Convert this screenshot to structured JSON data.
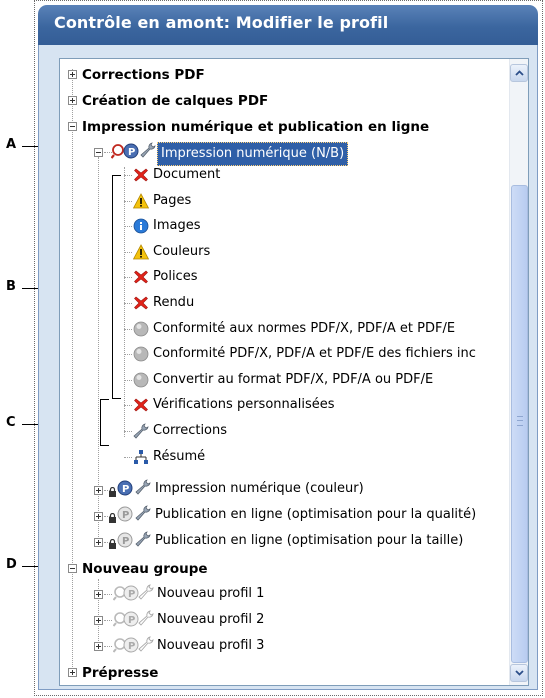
{
  "window": {
    "title": "Contrôle en amont: Modifier le profil"
  },
  "tree": {
    "corrections_pdf": "Corrections PDF",
    "creation_calques": "Création de calques PDF",
    "impression_publication": "Impression numérique et publication en ligne",
    "impression_nb": "Impression numérique (N/B)",
    "children": [
      {
        "label": "Document",
        "icon": "error-x-icon"
      },
      {
        "label": "Pages",
        "icon": "warning-icon"
      },
      {
        "label": "Images",
        "icon": "info-icon"
      },
      {
        "label": "Couleurs",
        "icon": "warning-icon"
      },
      {
        "label": "Polices",
        "icon": "error-x-icon"
      },
      {
        "label": "Rendu",
        "icon": "error-x-icon"
      },
      {
        "label": "Conformité aux normes PDF/X, PDF/A et PDF/E",
        "icon": "gray-circle-icon"
      },
      {
        "label": "Conformité PDF/X, PDF/A et PDF/E des fichiers inc",
        "icon": "gray-circle-icon"
      },
      {
        "label": "Convertir au format PDF/X, PDF/A ou PDF/E",
        "icon": "gray-circle-icon"
      },
      {
        "label": "Vérifications personnalisées",
        "icon": "error-x-icon"
      },
      {
        "label": "Corrections",
        "icon": "wrench-icon"
      },
      {
        "label": "Résumé",
        "icon": "hierarchy-icon"
      }
    ],
    "impression_couleur": "Impression numérique (couleur)",
    "publication_qualite": "Publication en ligne (optimisation pour la qualité)",
    "publication_taille": "Publication en ligne (optimisation pour la taille)",
    "nouveau_groupe": "Nouveau groupe",
    "nouveau_profil_1": "Nouveau profil 1",
    "nouveau_profil_2": "Nouveau profil 2",
    "nouveau_profil_3": "Nouveau profil 3",
    "prepresse": "Prépresse"
  },
  "callouts": {
    "a": "A",
    "b": "B",
    "c": "C",
    "d": "D"
  },
  "colors": {
    "title_bar": "#3b669f",
    "selection": "#2f5fa7",
    "error": "#e2231a",
    "warning": "#f4c20d",
    "info": "#2a7ad8"
  }
}
